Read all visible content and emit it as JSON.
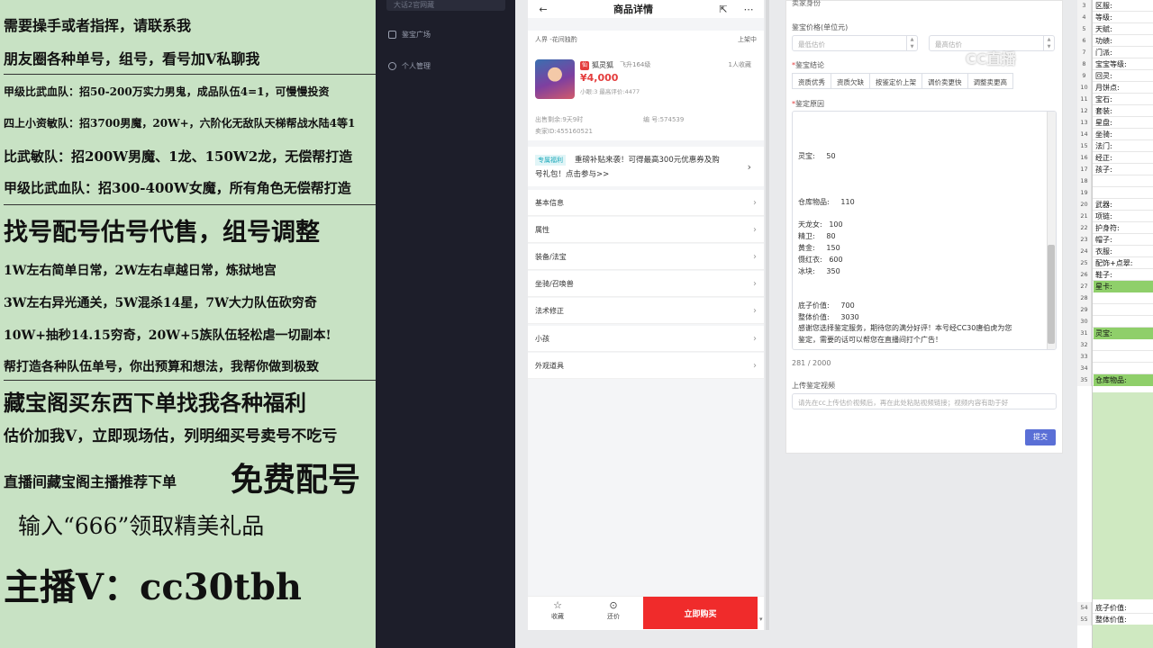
{
  "promo": {
    "lines": [
      "需要操手或者指挥，请联系我",
      "朋友圈各种单号，组号，看号加V私聊我",
      "甲级比武血队：招50-200万实力男鬼，成品队伍4=1，可慢慢投资",
      "四上小资敏队：招3700男魔，20W+，六阶化无敌队天梯帮战水陆4等1",
      "比武敏队：招200W男魔、1龙、150W2龙，无偿帮打造",
      "甲级比武血队：招300-400W女魔，所有角色无偿帮打造",
      "找号配号估号代售，组号调整",
      "1W左右简单日常，2W左右卓越日常，炼狱地宫",
      "3W左右异光通关，5W混杀14星，7W大力队伍砍穷奇",
      "10W+抽秒14.15穷奇，20W+5族队伍轻松虐一切副本!",
      "帮打造各种队伍单号，你出预算和想法，我帮你做到极致",
      "藏宝阁买东西下单找我各种福利",
      "估价加我V，立即现场估，列明细买号卖号不吃亏",
      "直播间藏宝阁主播推荐下单",
      "免费配号",
      "输入“666”领取精美礼品",
      "主播V：cc30tbh"
    ]
  },
  "sidebar": {
    "top": "大话2官网藏",
    "items": [
      {
        "label": "鉴宝广场",
        "icon": "document-icon"
      },
      {
        "label": "个人管理",
        "icon": "user-icon"
      }
    ]
  },
  "phone": {
    "title": "商品详情",
    "realm": "人界 -花间独酌",
    "status": "上架中",
    "goods": {
      "tag": "仙",
      "name": "狐灵狐",
      "level": "飞升164级",
      "favorites": "1人收藏",
      "price": "¥4,000",
      "sub": "小眼:3 最高评价:4477",
      "remaining": "出售剩余:9天9时",
      "code": "编  号:574539",
      "seller_id": "卖家ID:455160521"
    },
    "banner": {
      "tag": "专属福利",
      "text1": "重磅补贴来袭！可得最高300元优惠券及购",
      "text2": "号礼包！点击参与>>"
    },
    "menu": [
      "基本信息",
      "属性",
      "装备/法宝",
      "坐骑/召唤兽",
      "法术修正",
      "小孩",
      "外观道具"
    ],
    "bottom": {
      "fav": "收藏",
      "bargain": "还价",
      "buy": "立即购买"
    }
  },
  "form": {
    "seller_header": "卖家身份",
    "price_label": "鉴宝价格(单位元)",
    "min_placeholder": "最低估价",
    "max_placeholder": "最高估价",
    "conclusion_label": "鉴宝结论",
    "conclusion_buttons": [
      "资质优秀",
      "资质欠缺",
      "按鉴定价上架",
      "调价卖更快",
      "调整卖更高"
    ],
    "reason_label": "鉴定原因",
    "reason_lines": [
      "灵宝:     50",
      "仓库物品:     110",
      "天龙女:   100",
      "精卫:     80",
      "黄金:     150",
      "慑红衣:   600",
      "冰块:     350",
      "底子价值:     700",
      "整体价值:     3030",
      "感谢您选择鉴定服务，期待您的满分好评！本号经CC30唐伯虎为您",
      "鉴定，需要的话可以帮您在直播间打个广告！"
    ],
    "char_count": "281 / 2000",
    "video_label": "上传鉴定视频",
    "video_placeholder": "请先在cc上传估价视频后，再在此处粘贴视频链接；视频内容有助于好",
    "submit": "提交"
  },
  "watermark": "CC直播",
  "sheet": {
    "rows": [
      {
        "n": "3",
        "text": "区服:"
      },
      {
        "n": "4",
        "text": "等级:"
      },
      {
        "n": "5",
        "text": "天赋:"
      },
      {
        "n": "6",
        "text": "功绩:"
      },
      {
        "n": "7",
        "text": "门派:"
      },
      {
        "n": "8",
        "text": "宝宝等级:"
      },
      {
        "n": "9",
        "text": "回灵:"
      },
      {
        "n": "10",
        "text": "月饼点:"
      },
      {
        "n": "11",
        "text": "宝石:"
      },
      {
        "n": "12",
        "text": "套装:"
      },
      {
        "n": "13",
        "text": "星盘:"
      },
      {
        "n": "14",
        "text": "坐骑:"
      },
      {
        "n": "15",
        "text": "法门:"
      },
      {
        "n": "16",
        "text": "经正:"
      },
      {
        "n": "17",
        "text": "孩子:"
      },
      {
        "n": "18",
        "text": ""
      },
      {
        "n": "19",
        "text": ""
      },
      {
        "n": "20",
        "text": "武器:"
      },
      {
        "n": "21",
        "text": "项链:"
      },
      {
        "n": "22",
        "text": "护身符:"
      },
      {
        "n": "23",
        "text": "帽子:"
      },
      {
        "n": "24",
        "text": "衣服:"
      },
      {
        "n": "25",
        "text": "配饰+点翠:"
      },
      {
        "n": "26",
        "text": "鞋子:"
      },
      {
        "n": "27",
        "text": "星卡:"
      },
      {
        "n": "28",
        "text": ""
      },
      {
        "n": "29",
        "text": ""
      },
      {
        "n": "30",
        "text": ""
      },
      {
        "n": "31",
        "text": "灵宝:"
      },
      {
        "n": "32",
        "text": ""
      },
      {
        "n": "33",
        "text": ""
      },
      {
        "n": "34",
        "text": ""
      },
      {
        "n": "35",
        "text": "仓库物品:"
      }
    ],
    "bottom_rows": [
      {
        "n": "54",
        "text": "底子价值:"
      },
      {
        "n": "55",
        "text": "整体价值:"
      }
    ]
  }
}
